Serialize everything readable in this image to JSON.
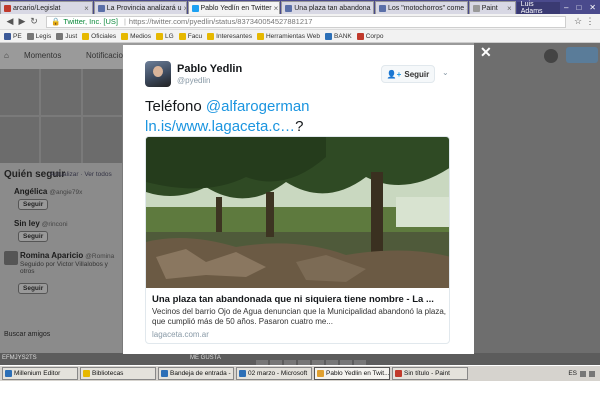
{
  "browser": {
    "tabs": [
      {
        "label": "arcario/Legislat",
        "color": "#c0392b",
        "active": false
      },
      {
        "label": "La Provincia analizará u",
        "color": "#5a6fa8",
        "active": false
      },
      {
        "label": "Pablo Yedlín en Twitter",
        "color": "#1da1f2",
        "active": true
      },
      {
        "label": "Una plaza tan abandona",
        "color": "#5a6fa8",
        "active": false
      },
      {
        "label": "Los \"motochorros\" come",
        "color": "#5a6fa8",
        "active": false
      },
      {
        "label": "Paint",
        "color": "#999999",
        "active": false
      }
    ],
    "user_chip": "Luis Adams",
    "url_secure": "Twitter, Inc. [US]",
    "url": "https://twitter.com/pyedlin/status/837340054527881217",
    "bookmarks": [
      {
        "label": "PE",
        "color": "#3b5998"
      },
      {
        "label": "Legis",
        "color": "#777777"
      },
      {
        "label": "Just",
        "color": "#777777"
      },
      {
        "label": "Oficiales",
        "color": "#e6b800"
      },
      {
        "label": "Medios",
        "color": "#e6b800"
      },
      {
        "label": "LG",
        "color": "#e6b800"
      },
      {
        "label": "Facu",
        "color": "#e6b800"
      },
      {
        "label": "Interesantes",
        "color": "#e6b800"
      },
      {
        "label": "Herramientas Web",
        "color": "#e6b800"
      },
      {
        "label": "BANK",
        "color": "#2c6fb7"
      },
      {
        "label": "Corpo",
        "color": "#c0392b"
      }
    ]
  },
  "background_page": {
    "nav": {
      "moments": "Momentos",
      "notifications": "Notificaciones"
    },
    "who_to_follow": {
      "title": "Quién seguir",
      "links": "Actualizar · Ver todos",
      "items": [
        {
          "name": "Angélica",
          "handle": "@angie79x",
          "sub": "",
          "follow": "Seguir"
        },
        {
          "name": "Sin ley",
          "handle": "@rinconi",
          "sub": "",
          "follow": "Seguir"
        },
        {
          "name": "Romina Aparicio",
          "handle": "@Romina",
          "sub": "Seguido por Victor Villalobos y otros",
          "follow": "Seguir"
        }
      ],
      "more": "Buscar amigos"
    },
    "bottom_text": "EFMJYS2TS",
    "likes_label": "ME GUSTA"
  },
  "tweet": {
    "author_name": "Pablo Yedlin",
    "author_handle": "@pyedlin",
    "follow_label": "Seguir",
    "text_prefix": "Teléfono ",
    "mention": "@alfarogerman",
    "link": "ln.is/www.lagaceta.c…",
    "text_suffix": "?",
    "card": {
      "title": "Una plaza tan abandonada que ni siquiera tiene nombre - La ...",
      "description": "Vecinos del barrio Ojo de Agua denuncian que la Municipalidad abandonó la plaza, que cumplió más de 50 años. Pasaron cuatro me...",
      "domain": "lagaceta.com.ar"
    }
  },
  "taskbar": {
    "tasks": [
      {
        "label": "Millenium Editor",
        "color": "#2c6fb7",
        "active": false
      },
      {
        "label": "Bibliotecas",
        "color": "#e6b800",
        "active": false
      },
      {
        "label": "Bandeja de entrada -",
        "color": "#2c6fb7",
        "active": false
      },
      {
        "label": "02 marzo - Microsoft",
        "color": "#2c6fb7",
        "active": false
      },
      {
        "label": "Pablo Yedlin en Twit...",
        "color": "#e0a030",
        "active": true
      },
      {
        "label": "Sin título - Paint",
        "color": "#c0392b",
        "active": false
      }
    ],
    "tray_lang": "ES"
  }
}
